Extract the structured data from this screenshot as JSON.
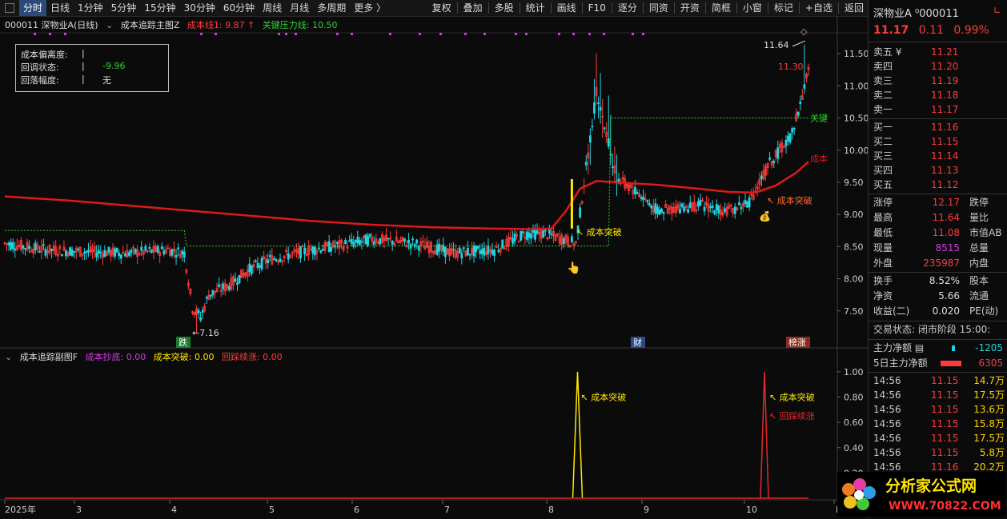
{
  "toolbar": {
    "periods": [
      "分时",
      "日线",
      "1分钟",
      "5分钟",
      "15分钟",
      "30分钟",
      "60分钟",
      "周线",
      "月线",
      "多周期",
      "更多 〉"
    ],
    "actions": [
      "复权",
      "叠加",
      "多股",
      "统计",
      "画线",
      "F10",
      "逐分",
      "同资",
      "开资",
      "简框",
      "小窗",
      "标记",
      "+自选",
      "返回"
    ]
  },
  "header": {
    "stock": "000011 深物业A(日线)",
    "indicator": "成本追踪主图Z",
    "cost_line_label": "成本线1: 9.87",
    "pressure_label": "关键压力线: 10.50"
  },
  "info_box": {
    "rows": [
      {
        "key": "成本偏离度:",
        "val": ""
      },
      {
        "key": "回调状态:",
        "val": "-9.96"
      },
      {
        "key": "回落幅度:",
        "val": "无"
      }
    ]
  },
  "sub_header": {
    "name": "成本追踪副图F",
    "s1": "成本抄底: 0.00",
    "s2": "成本突破: 0.00",
    "s3": "回踩续涨: 0.00"
  },
  "annotations": {
    "low": "←7.16",
    "high": "11.64",
    "last": "11.30",
    "breakout": "成本突破",
    "pressure_short": "关键",
    "cost_short": "成本",
    "sub_breakout": "成本突破",
    "sub_pullback": "回踩续涨",
    "badge_die": "跌",
    "badge_cai": "财",
    "badge_zhang": "榜涨"
  },
  "right_panel": {
    "title": "深物业A ⁰000011",
    "price": "11.17",
    "change": "0.11",
    "pct": "0.99%",
    "asks": [
      [
        "卖五 ¥",
        "11.21"
      ],
      [
        "卖四",
        "11.20"
      ],
      [
        "卖三",
        "11.19"
      ],
      [
        "卖二",
        "11.18"
      ],
      [
        "卖一",
        "11.17"
      ]
    ],
    "bids": [
      [
        "买一",
        "11.16"
      ],
      [
        "买二",
        "11.15"
      ],
      [
        "买三",
        "11.14"
      ],
      [
        "买四",
        "11.13"
      ],
      [
        "买五",
        "11.12"
      ]
    ],
    "stats": [
      [
        "涨停",
        "12.17",
        "跌停"
      ],
      [
        "最高",
        "11.64",
        "量比"
      ],
      [
        "最低",
        "11.08",
        "市值AB"
      ],
      [
        "现量",
        "8515",
        "总量"
      ],
      [
        "外盘",
        "235987",
        "内盘"
      ],
      [
        "换手",
        "8.52%",
        "股本"
      ],
      [
        "净资",
        "5.66",
        "流通"
      ],
      [
        "收益(二)",
        "0.020",
        "PE(动)"
      ]
    ],
    "trade_status": "交易状态: 闭市阶段 15:00:",
    "main_flow": "主力净额",
    "main_flow_val": "-1205",
    "main_flow5": "5日主力净额",
    "main_flow5_val": "6305",
    "ticks": [
      [
        "14:56",
        "11.15",
        "14.7万"
      ],
      [
        "14:56",
        "11.15",
        "17.5万"
      ],
      [
        "14:56",
        "11.15",
        "13.6万"
      ],
      [
        "14:56",
        "11.15",
        "15.8万"
      ],
      [
        "14:56",
        "11.15",
        "17.5万"
      ],
      [
        "14:56",
        "11.15",
        "5.8万"
      ],
      [
        "14:56",
        "11.16",
        "20.2万"
      ]
    ]
  },
  "logo": {
    "text1": "分析家公式网",
    "text2": "WWW.70822.COM"
  },
  "colors": {
    "up": "#ff3b3b",
    "down": "#1fd4e0",
    "cost": "#e01818",
    "pressure": "#2fd42f",
    "breakout": "#ffe600",
    "pullback": "#e22a2a"
  },
  "chart_data": [
    {
      "type": "candlestick",
      "title": "",
      "y_ticks": [
        7.5,
        8.0,
        8.5,
        9.0,
        9.5,
        10.0,
        10.5,
        11.0,
        11.5
      ],
      "ylim": [
        6.95,
        11.85
      ],
      "x_ticks": [
        "2025年",
        "3",
        "4",
        "5",
        "6",
        "7",
        "8",
        "9",
        "10",
        "E"
      ],
      "cost_line": [
        [
          0,
          9.28
        ],
        [
          30,
          9.22
        ],
        [
          60,
          9.14
        ],
        [
          90,
          9.06
        ],
        [
          120,
          8.98
        ],
        [
          150,
          8.9
        ],
        [
          180,
          8.84
        ],
        [
          210,
          8.8
        ],
        [
          240,
          8.78
        ],
        [
          260,
          8.77
        ],
        [
          268,
          8.78
        ],
        [
          275,
          9.05
        ],
        [
          282,
          9.4
        ],
        [
          290,
          9.52
        ],
        [
          300,
          9.5
        ],
        [
          320,
          9.46
        ],
        [
          340,
          9.4
        ],
        [
          355,
          9.35
        ],
        [
          368,
          9.34
        ],
        [
          378,
          9.45
        ],
        [
          388,
          9.65
        ],
        [
          394,
          9.82
        ]
      ],
      "pressure_line": [
        [
          0,
          8.75
        ],
        [
          88,
          8.75
        ],
        [
          89,
          8.51
        ],
        [
          296,
          8.51
        ],
        [
          297,
          10.5
        ],
        [
          394,
          10.5
        ]
      ],
      "low_point": 7.16,
      "high_point": 11.64,
      "last_close": 11.3,
      "signals": [
        {
          "name": "成本突破",
          "x": 268
        },
        {
          "name": "成本突破",
          "x": 372
        },
        {
          "name": "跌",
          "x": 88
        },
        {
          "name": "财",
          "x": 310
        },
        {
          "name": "榜涨",
          "x": 387
        }
      ]
    },
    {
      "type": "line",
      "title": "",
      "y_ticks": [
        0.2,
        0.4,
        0.6,
        0.8,
        1.0
      ],
      "ylim": [
        0,
        1.05
      ],
      "series": [
        {
          "name": "成本突破",
          "peaks": [
            {
              "x": 280,
              "y": 1.0
            }
          ]
        },
        {
          "name": "回踩续涨",
          "peaks": [
            {
              "x": 374,
              "y": 1.0
            }
          ]
        }
      ]
    }
  ]
}
